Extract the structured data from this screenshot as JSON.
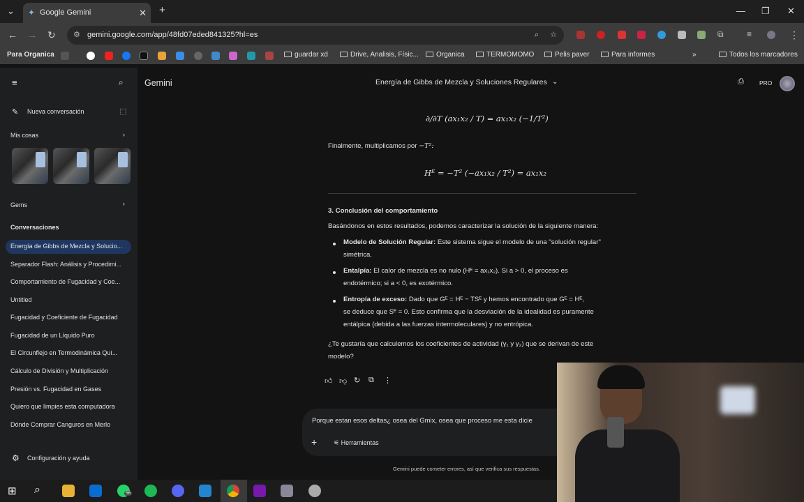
{
  "browser": {
    "tab_title": "Google Gemini",
    "url": "gemini.google.com/app/48fd07eded841325?hl=es",
    "bookmarks": [
      "Para Organica",
      "guardar xd",
      "Drive, Analisis, Físic...",
      "Organica",
      "TERMOMOMO",
      "Pelis paver",
      "Para informes",
      "Todos los marcadores"
    ]
  },
  "sidebar": {
    "new_chat": "Nueva conversación",
    "my_stuff": "Mis cosas",
    "gems": "Gems",
    "conversations_label": "Conversaciones",
    "conversations": [
      "Energía de Gibbs de Mezcla y Solucio...",
      "Separador Flash: Análisis y Procedimi...",
      "Comportamiento de Fugacidad y Coe...",
      "Untitled",
      "Fugacidad y Coeficiente de Fugacidad",
      "Fugacidad de un Líquido Puro",
      "El Circunflejo en Termodinámica Quí...",
      "Cálculo de División y Multiplicación",
      "Presión vs. Fugacidad en Gases",
      "Quiero que limpies esta computadora",
      "Dónde Comprar Canguros en Merlo"
    ],
    "settings": "Configuración y ayuda"
  },
  "header": {
    "app_name": "Gemini",
    "chat_title": "Energía de Gibbs de Mezcla y Soluciones Regulares",
    "badge": "PRO"
  },
  "content": {
    "eq1_lhs": "∂/∂T",
    "eq1": "∂/∂T (ax₁x₂ / T) = ax₁x₂ (−1/T²)",
    "text_mult": "Finalmente, multiplicamos por",
    "text_mult_math": "−T²:",
    "eq2": "Hᴱ = −T² (−ax₁x₂ / T²) = ax₁x₂",
    "section_title": "3. Conclusión del comportamiento",
    "intro": "Basándonos en estos resultados, podemos caracterizar la solución de la siguiente manera:",
    "b1_title": "Modelo de Solución Regular:",
    "b1_text": " Este sistema sigue el modelo de una \"solución regular\"",
    "b1_text2": "simétrica.",
    "b2_title": "Entalpía:",
    "b2_text": " El calor de mezcla es no nulo (Hᴱ = ax₁x₂). Si a > 0, el proceso es",
    "b2_text2": "endotérmico; si a < 0, es exotérmico.",
    "b3_title": "Entropía de exceso:",
    "b3_text": " Dado que Gᴱ = Hᴱ − TSᴱ y hemos encontrado que Gᴱ = Hᴱ,",
    "b3_text2": "se deduce que Sᴱ = 0. Esto confirma que la desviación de la idealidad es puramente",
    "b3_text3": "entálpica (debida a las fuerzas intermoleculares) y no entrópica.",
    "question": "¿Te gustaría que calculemos los coeficientes de actividad (γ₁ y γ₂) que se derivan de este",
    "question2": "modelo?"
  },
  "input": {
    "value": "Porque estan esos deltas¿ osea  del  Gmix, osea que proceso me esta dicie",
    "tools": "Herramientas",
    "disclaimer": "Gemini puede cometer errores, así que verifica sus respuestas."
  },
  "taskbar": {
    "whatsapp_badge": "56"
  }
}
